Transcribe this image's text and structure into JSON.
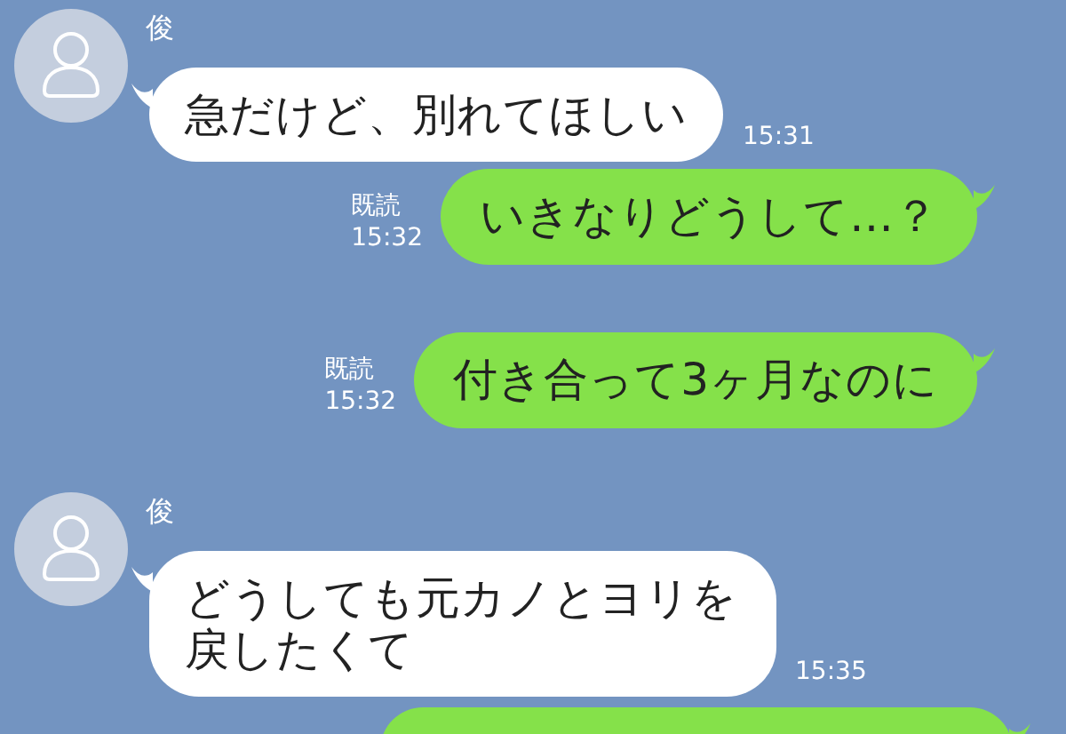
{
  "messages": [
    {
      "kind": "received",
      "sender": "俊",
      "text": "急だけど、別れてほしい",
      "time": "15:31"
    },
    {
      "kind": "sent",
      "read": "既読",
      "time": "15:32",
      "text": "いきなりどうして…？"
    },
    {
      "kind": "sent",
      "read": "既読",
      "time": "15:32",
      "text": "付き合って3ヶ月なのに"
    },
    {
      "kind": "received",
      "sender": "俊",
      "text": "どうしても元カノとヨリを戻したくて",
      "time": "15:35"
    },
    {
      "kind": "sent_partial"
    }
  ]
}
